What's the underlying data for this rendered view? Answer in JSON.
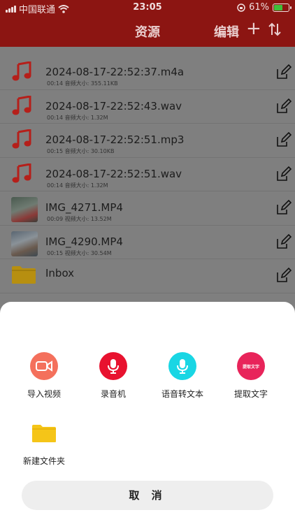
{
  "status_bar": {
    "carrier": "中国联通",
    "time": "23:05",
    "battery": "61%",
    "battery_level": 0.61
  },
  "nav": {
    "title": "资源",
    "edit_label": "编辑",
    "add_icon": "plus-icon",
    "sort_icon": "sort-icon"
  },
  "files": [
    {
      "name": "2024-08-17-22:52:37.m4a",
      "meta": "00:14 音频大小: 355.11KB",
      "type": "audio"
    },
    {
      "name": "2024-08-17-22:52:43.wav",
      "meta": "00:14 音频大小: 1.32M",
      "type": "audio"
    },
    {
      "name": "2024-08-17-22:52:51.mp3",
      "meta": "00:15 音频大小: 30.10KB",
      "type": "audio"
    },
    {
      "name": "2024-08-17-22:52:51.wav",
      "meta": "00:14 音频大小: 1.32M",
      "type": "audio"
    },
    {
      "name": "IMG_4271.MP4",
      "meta": "00:09 视频大小: 13.52M",
      "type": "video"
    },
    {
      "name": "IMG_4290.MP4",
      "meta": "00:15 视频大小: 30.54M",
      "type": "video"
    },
    {
      "name": "Inbox",
      "meta": "",
      "type": "folder"
    }
  ],
  "sheet": {
    "actions": [
      {
        "label": "导入视频",
        "icon": "video-camera-icon",
        "color": "#f4705c"
      },
      {
        "label": "录音机",
        "icon": "microphone-icon",
        "color": "#e8122f"
      },
      {
        "label": "语音转文本",
        "icon": "microphone-icon",
        "color": "#19d6e4"
      },
      {
        "label": "提取文字",
        "icon": "extract-text-icon",
        "color": "#e8245a",
        "badge": "提取文字"
      },
      {
        "label": "新建文件夹",
        "icon": "folder-icon",
        "color": "#f5c518"
      }
    ],
    "cancel_label": "取 消"
  },
  "colors": {
    "header": "#8c1512",
    "dim": "#7f7f7f",
    "accent": "#b51f1a"
  }
}
